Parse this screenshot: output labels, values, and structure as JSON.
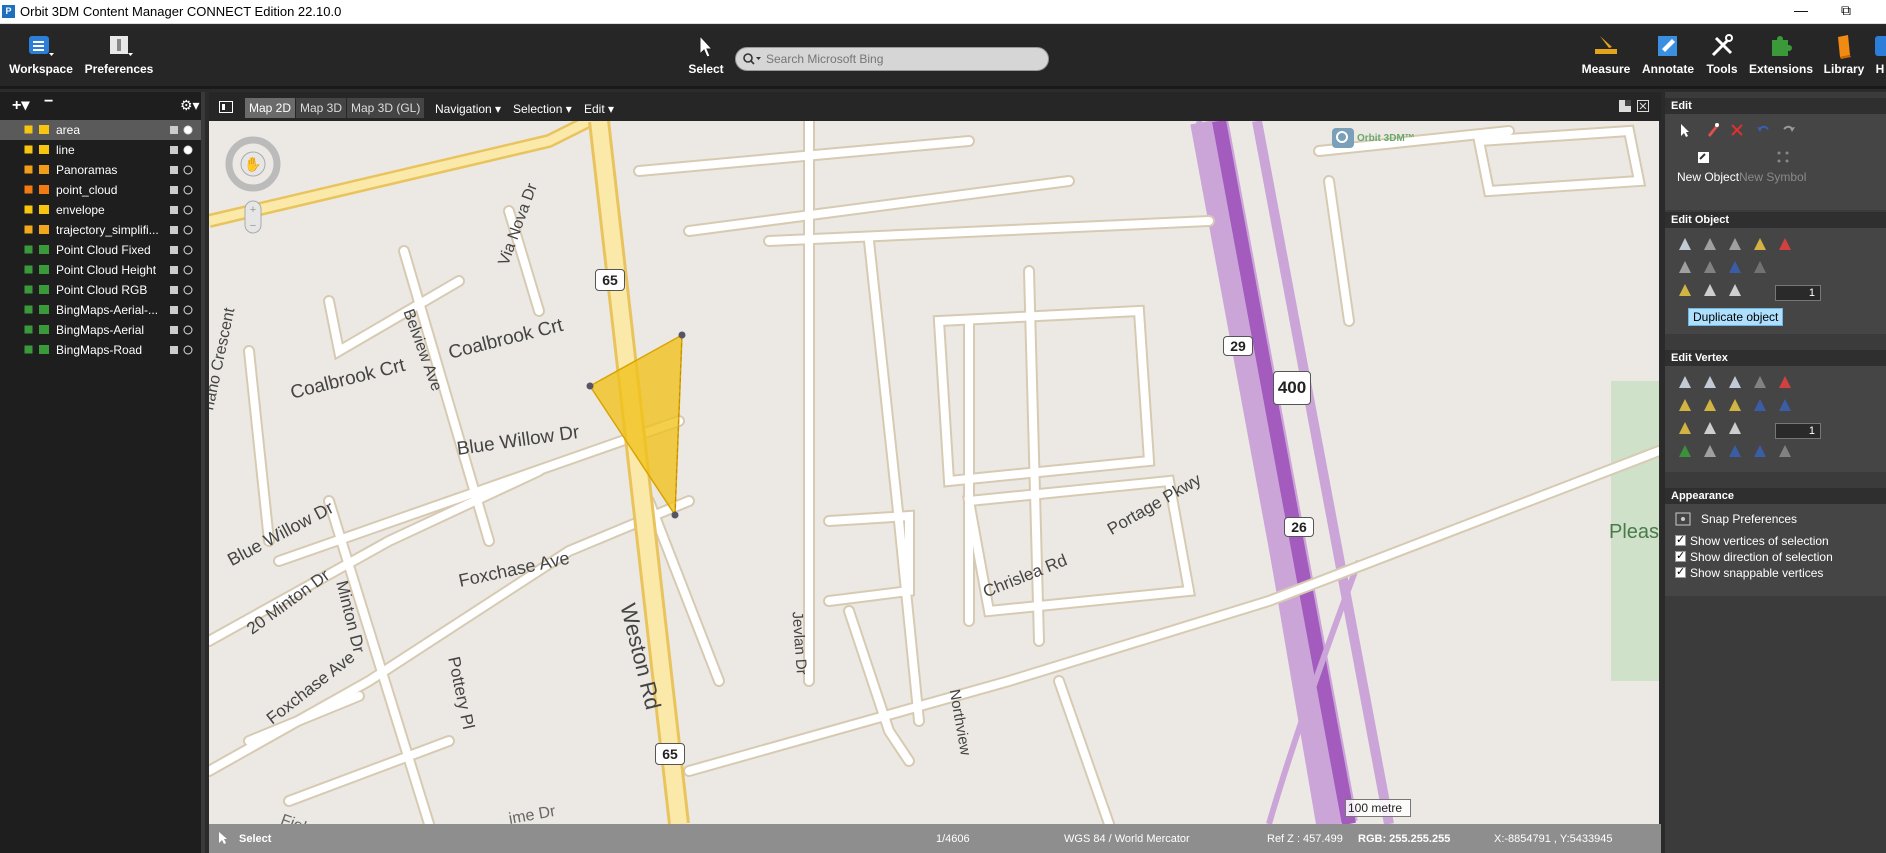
{
  "window": {
    "title": "Orbit 3DM Content Manager CONNECT Edition 22.10.0",
    "app_icon": "P",
    "minimize": "—",
    "restore": "⧉"
  },
  "toolbar": {
    "workspace": "Workspace",
    "preferences": "Preferences",
    "select": "Select",
    "search_placeholder": "Search Microsoft Bing",
    "measure": "Measure",
    "annotate": "Annotate",
    "tools": "Tools",
    "extensions": "Extensions",
    "library": "Library",
    "help": "H"
  },
  "layers_panel": {
    "add": "+▾",
    "remove": "−",
    "settings": "⚙▾",
    "layers": [
      {
        "name": "area",
        "color": "#f7c50f",
        "selected": true,
        "action_icon": "puzzle-icon"
      },
      {
        "name": "line",
        "color": "#f7c50f",
        "selected": false,
        "action_icon": "puzzle-icon"
      },
      {
        "name": "Panoramas",
        "color": "#f29d18",
        "selected": false,
        "action_icon": "pin-icon"
      },
      {
        "name": "point_cloud",
        "color": "#f27a12",
        "selected": false,
        "action_icon": "pin-icon"
      },
      {
        "name": "envelope",
        "color": "#f7c50f",
        "selected": false,
        "action_icon": "pin-icon"
      },
      {
        "name": "trajectory_simplifi...",
        "color": "#f2a81d",
        "selected": false,
        "action_icon": "pin-icon"
      },
      {
        "name": "Point Cloud Fixed",
        "color": "#3a9a3a",
        "selected": false,
        "action_icon": "pin-icon"
      },
      {
        "name": "Point Cloud Height",
        "color": "#3a9a3a",
        "selected": false,
        "action_icon": "pin-icon"
      },
      {
        "name": "Point Cloud RGB",
        "color": "#3a9a3a",
        "selected": false,
        "action_icon": "pin-icon"
      },
      {
        "name": "BingMaps-Aerial-...",
        "color": "#3a9a3a",
        "selected": false,
        "action_icon": "puzzle-icon"
      },
      {
        "name": "BingMaps-Aerial",
        "color": "#3a9a3a",
        "selected": false,
        "action_icon": "puzzle-icon"
      },
      {
        "name": "BingMaps-Road",
        "color": "#3a9a3a",
        "selected": false,
        "action_icon": "puzzle-icon"
      }
    ]
  },
  "map_tabs": {
    "tab_2d": "Map 2D",
    "tab_3d": "Map 3D",
    "tab_3d_gl": "Map 3D (GL)",
    "navigation": "Navigation ▾",
    "selection": "Selection ▾",
    "edit": "Edit ▾"
  },
  "map": {
    "logo": "Orbit 3DM™",
    "scale": "100 metre",
    "labels": {
      "belview": "Belview Ave",
      "via_nova": "Via Nova Dr",
      "crescent": "nano Crescent",
      "coalbrook1": "Coalbrook Crt",
      "coalbrook2": "Coalbrook Crt",
      "blue_willow1": "Blue Willow Dr",
      "blue_willow2": "Blue Willow Dr",
      "minton": "Minton Dr",
      "minton20": "20 Minton Dr",
      "foxchase1": "Foxchase Ave",
      "foxchase2": "Foxchase Ave",
      "pottery": "Pottery Pl",
      "weston": "Weston Rd",
      "jevlan": "Jevlan Dr",
      "chrislea": "Chrislea Rd",
      "portage": "Portage Pkwy",
      "northview": "Northview",
      "plea": "Pleas",
      "fiel": "Fiel",
      "ime": "ime Dr",
      "shield_65a": "65",
      "shield_65b": "65",
      "shield_29": "29",
      "shield_400": "400",
      "shield_26": "26"
    }
  },
  "status": {
    "mode": "Select",
    "zoom": "1/4606",
    "crs": "WGS 84 / World Mercator",
    "refz": "Ref Z : 457.499",
    "rgb": "RGB: 255.255.255",
    "coords": "X:-8854791 , Y:5433945"
  },
  "edit_panel": {
    "header": "Edit",
    "new_object": "New Object",
    "new_symbol": "New Symbol",
    "edit_object": "Edit Object",
    "obj_value": "1",
    "duplicate": "Duplicate object",
    "edit_vertex": "Edit Vertex",
    "vertex_value": "1",
    "appearance": "Appearance",
    "snap_preferences": "Snap Preferences",
    "show_vertices": "Show vertices of selection",
    "show_direction": "Show direction of selection",
    "show_snappable": "Show snappable vertices"
  }
}
